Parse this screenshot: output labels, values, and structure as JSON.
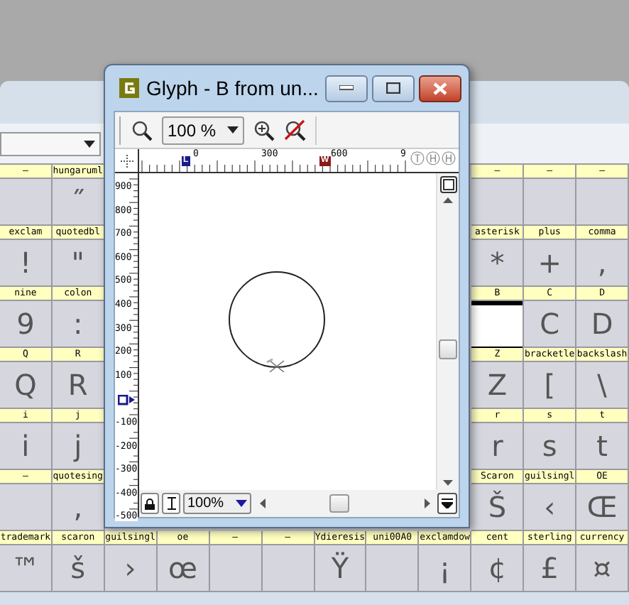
{
  "font_view": {
    "rows": [
      {
        "cells": [
          {
            "label": "—",
            "selected": false
          },
          {
            "label": "hungaruml",
            "glyph": "˝",
            "selected": false
          },
          {
            "label": "—",
            "selected": false
          },
          {
            "label": "—",
            "selected": false
          },
          {
            "label": "—",
            "selected": false
          }
        ]
      },
      {
        "cells": [
          {
            "label": "exclam",
            "glyph": "!",
            "selected": false
          },
          {
            "label": "quotedbl",
            "glyph": "\"",
            "selected": false
          },
          {
            "label": "asterisk",
            "glyph": "*",
            "selected": false
          },
          {
            "label": "plus",
            "glyph": "+",
            "selected": false
          },
          {
            "label": "comma",
            "glyph": ",",
            "selected": false
          }
        ]
      },
      {
        "cells": [
          {
            "label": "nine",
            "glyph": "9",
            "selected": false
          },
          {
            "label": "colon",
            "glyph": ":",
            "selected": false
          },
          {
            "label": "B",
            "selected": true
          },
          {
            "label": "C",
            "glyph": "C",
            "selected": false
          },
          {
            "label": "D",
            "glyph": "D",
            "selected": false
          }
        ]
      },
      {
        "cells": [
          {
            "label": "Q",
            "glyph": "Q",
            "selected": false
          },
          {
            "label": "R",
            "glyph": "R",
            "selected": false
          },
          {
            "label": "Z",
            "glyph": "Z",
            "selected": false
          },
          {
            "label": "bracketle",
            "glyph": "[",
            "selected": false
          },
          {
            "label": "backslash",
            "glyph": "\\",
            "selected": false
          }
        ]
      },
      {
        "cells": [
          {
            "label": "i",
            "glyph": "i",
            "selected": false
          },
          {
            "label": "j",
            "glyph": "j",
            "selected": false
          },
          {
            "label": "r",
            "glyph": "r",
            "selected": false
          },
          {
            "label": "s",
            "glyph": "s",
            "selected": false
          },
          {
            "label": "t",
            "glyph": "t",
            "selected": false
          }
        ]
      },
      {
        "cells": [
          {
            "label": "—",
            "selected": false
          },
          {
            "label": "quotesing",
            "glyph": ",",
            "selected": false
          },
          {
            "label": "Scaron",
            "glyph": "Š",
            "selected": false
          },
          {
            "label": "guilsingl",
            "glyph": "‹",
            "selected": false
          },
          {
            "label": "OE",
            "glyph": "Œ",
            "selected": false
          }
        ]
      },
      {
        "cells": [
          {
            "label": "trademark",
            "glyph": "™",
            "selected": false
          },
          {
            "label": "scaron",
            "glyph": "š",
            "selected": false
          },
          {
            "label": "guilsingl",
            "glyph": "›",
            "selected": false
          },
          {
            "label": "oe",
            "glyph": "œ",
            "selected": false
          },
          {
            "label": "—",
            "selected": false
          },
          {
            "label": "—",
            "selected": false
          },
          {
            "label": "Ydieresis",
            "glyph": "Ÿ",
            "selected": false
          },
          {
            "label": "uni00A0",
            "selected": false
          },
          {
            "label": "exclamdow",
            "glyph": "¡",
            "selected": false
          },
          {
            "label": "cent",
            "glyph": "¢",
            "selected": false
          },
          {
            "label": "sterling",
            "glyph": "£",
            "selected": false
          },
          {
            "label": "currency",
            "glyph": "¤",
            "selected": false
          }
        ]
      }
    ]
  },
  "glyph_window": {
    "title": "Glyph - B from un...",
    "zoom": "100 %",
    "top_ruler_labels": [
      "0",
      "300",
      "600",
      "9"
    ],
    "ruler_markers": [
      {
        "label": "L",
        "color": "#1a1a8c"
      },
      {
        "label": "W",
        "color": "#8c1a1a"
      }
    ],
    "ruler_toggles": [
      "Ⓣ",
      "Ⓗ",
      "Ⓗ"
    ],
    "side_ruler_labels": [
      "900",
      "800",
      "700",
      "600",
      "500",
      "400",
      "300",
      "200",
      "100",
      "-100",
      "-200",
      "-300",
      "-400",
      "-500"
    ],
    "bottom_zoom": "100%"
  }
}
